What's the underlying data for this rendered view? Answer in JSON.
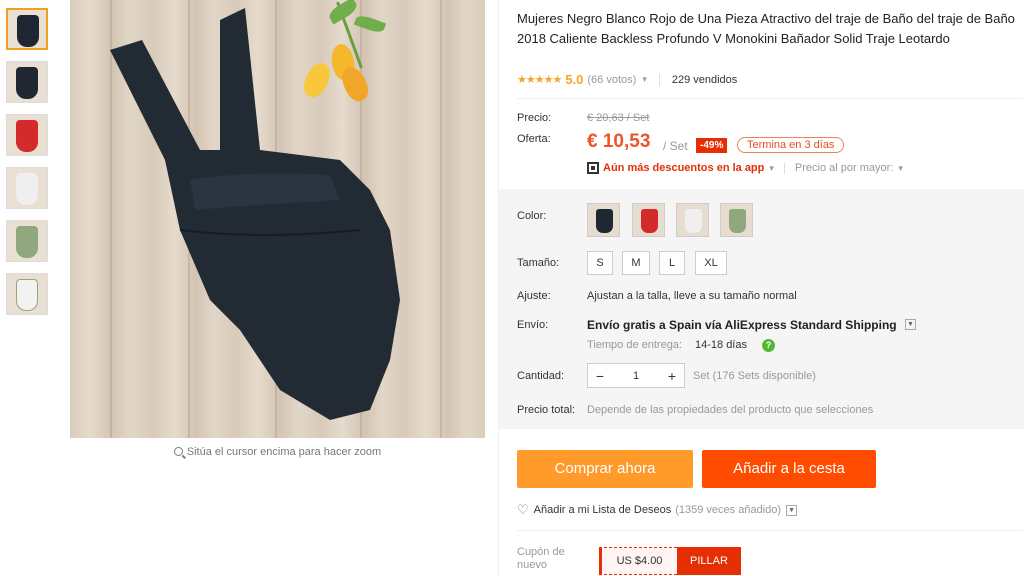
{
  "product": {
    "title": "Mujeres Negro Blanco Rojo de Una Pieza Atractivo del traje de Baño del traje de Baño 2018 Caliente Backless Profundo V Monokini Bañador Solid Traje Leotardo",
    "rating": "5.0",
    "votes": "(66 votos)",
    "sold": "229 vendidos"
  },
  "gallery": {
    "zoom_hint": "Sitúa el cursor encima para hacer zoom",
    "thumbnails": [
      {
        "color": "#1f2733"
      },
      {
        "color": "#1f2733"
      },
      {
        "color": "#d42a2a"
      },
      {
        "color": "#efefef"
      },
      {
        "color": "#8fa87e"
      },
      {
        "color": "#f2f2f2"
      }
    ]
  },
  "price": {
    "label": "Precio:",
    "original": "€ 20,63 / Set",
    "offer_label": "Oferta:",
    "current": "€ 10,53",
    "per": "/ Set",
    "discount": "-49%",
    "ends": "Termina en 3 días",
    "app_discount": "Aún más descuentos en la app",
    "wholesale": "Precio al por mayor:"
  },
  "options": {
    "color_label": "Color:",
    "colors": [
      "#1f2733",
      "#d42a2a",
      "#efefef",
      "#8fa87e"
    ],
    "size_label": "Tamaño:",
    "sizes": [
      "S",
      "M",
      "L",
      "XL"
    ],
    "fit_label": "Ajuste:",
    "fit_value": "Ajustan a la talla, lleve a su tamaño normal",
    "shipping_label": "Envío:",
    "shipping_value": "Envío gratis a Spain vía AliExpress Standard Shipping",
    "eta_label": "Tiempo de entrega:",
    "eta_value": "14-18 días",
    "quantity_label": "Cantidad:",
    "quantity": "1",
    "quantity_note": "Set (176 Sets disponible)",
    "total_label": "Precio total:",
    "total_value": "Depende de las propiedades del producto que selecciones"
  },
  "actions": {
    "buy_now": "Comprar ahora",
    "add_to_cart": "Añadir a la cesta",
    "wishlist": "Añadir a mi Lista de Deseos",
    "wishlist_count": "(1359 veces añadido)"
  },
  "coupon": {
    "label": "Cupón de nuevo",
    "amount": "US $4.00",
    "take": "PILLAR"
  },
  "colors": {
    "accent_orange": "#ff9a2b",
    "accent_red": "#ff4c00",
    "price_red": "#f0532a"
  }
}
